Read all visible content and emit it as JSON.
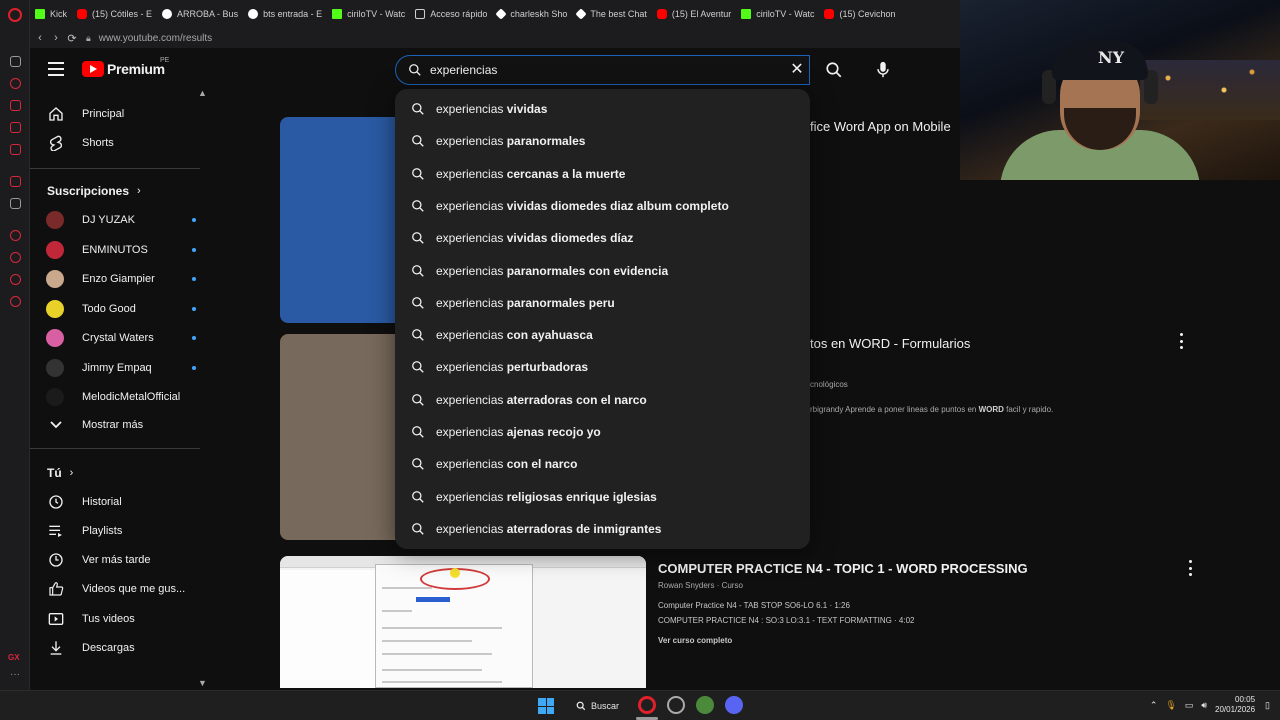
{
  "browser": {
    "tabs": [
      {
        "icon": "kick",
        "label": "Kick"
      },
      {
        "icon": "yt",
        "label": "(15) Cótiles - E"
      },
      {
        "icon": "gl",
        "label": "ARROBA - Bus"
      },
      {
        "icon": "gl",
        "label": "bts entrada - E"
      },
      {
        "icon": "kick",
        "label": "ciriloTV - Watc"
      },
      {
        "icon": "grid",
        "label": "Acceso rápido"
      },
      {
        "icon": "chat",
        "label": "charleskh Sho"
      },
      {
        "icon": "chat",
        "label": "The best Chat"
      },
      {
        "icon": "yt",
        "label": "(15) El Aventur"
      },
      {
        "icon": "kick",
        "label": "ciriloTV - Watc"
      },
      {
        "icon": "yt",
        "label": "(15) Cevichon"
      }
    ],
    "url": "www.youtube.com/results"
  },
  "header": {
    "logo_text": "Premium",
    "country": "PE",
    "search_value": "experiencias"
  },
  "sidebar": {
    "main": [
      {
        "label": "Principal",
        "icon": "home-icon"
      },
      {
        "label": "Shorts",
        "icon": "shorts-icon"
      }
    ],
    "subs_title": "Suscripciones",
    "subs": [
      {
        "label": "DJ YUZAK",
        "color": "#7a2a2a"
      },
      {
        "label": "ENMINUTOS",
        "color": "#c0283a"
      },
      {
        "label": "Enzo Giampier",
        "color": "#c9a88c"
      },
      {
        "label": "Todo Good",
        "color": "#e8d22a"
      },
      {
        "label": "Crystal Waters",
        "color": "#d85fa2"
      },
      {
        "label": "Jimmy Empaq",
        "color": "#333333"
      },
      {
        "label": "MelodicMetalOfficial",
        "color": "#1b1b1b"
      }
    ],
    "show_more": "Mostrar más",
    "you_title": "Tú",
    "you": [
      {
        "label": "Historial",
        "icon": "history-icon"
      },
      {
        "label": "Playlists",
        "icon": "playlists-icon"
      },
      {
        "label": "Ver más tarde",
        "icon": "watch-later-icon"
      },
      {
        "label": "Videos que me gus...",
        "icon": "liked-icon"
      },
      {
        "label": "Tus videos",
        "icon": "your-videos-icon"
      },
      {
        "label": "Descargas",
        "icon": "downloads-icon"
      }
    ]
  },
  "suggestions": {
    "query": "experiencias",
    "items": [
      " vividas",
      " paranormales",
      " cercanas a la muerte",
      " vividas diomedes diaz album completo",
      " vividas diomedes díaz",
      " paranormales con evidencia",
      " paranormales peru",
      " con ayahuasca",
      " perturbadoras",
      " aterradoras con el narco",
      " ajenas recojo yo",
      " con el narco",
      " religiosas enrique iglesias",
      " aterradoras de inmigrantes"
    ]
  },
  "results": {
    "r1_title": "fice Word App on Mobile",
    "r2_title": "tos en WORD - Formularios",
    "r2_channel": "cnológicos",
    "r2_desc_pre": "rbigrandy Aprende a poner lineas de puntos en ",
    "r2_desc_bold": "WORD",
    "r2_desc_post": " facil y rapido.",
    "r3_title": "COMPUTER PRACTICE N4 - TOPIC 1 - WORD PROCESSING",
    "r3_channel": "Rowan Snyders · Curso",
    "r3_line1": "Computer Practice N4 - TAB STOP SO6-LO 6.1 · 1:26",
    "r3_line2": "COMPUTER PRACTICE N4 : SO:3 LO:3.1 - TEXT FORMATTING · 4:02",
    "r3_course": "Ver curso completo"
  },
  "taskbar": {
    "search_label": "Buscar",
    "time": "00:05",
    "date": "20/01/2026"
  }
}
